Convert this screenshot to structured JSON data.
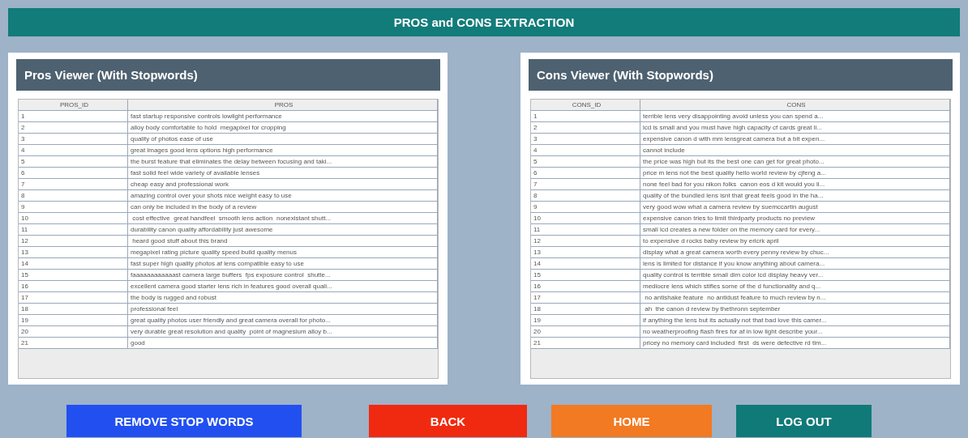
{
  "title": "PROS and CONS EXTRACTION",
  "viewers": [
    {
      "title": "Pros Viewer (With Stopwords)",
      "columns": [
        "PROS_ID",
        "PROS"
      ],
      "rows": [
        {
          "id": "1",
          "text": "fast startup responsive controls lowlight performance"
        },
        {
          "id": "2",
          "text": "alloy body comfortable to hold  megapixel for cropping"
        },
        {
          "id": "3",
          "text": "quality of photos ease of use"
        },
        {
          "id": "4",
          "text": "great images good lens options high performance"
        },
        {
          "id": "5",
          "text": "the burst feature that eliminates the delay between focusing and taki..."
        },
        {
          "id": "6",
          "text": "fast solid feel wide variety of available lenses"
        },
        {
          "id": "7",
          "text": "cheap easy and professional work"
        },
        {
          "id": "8",
          "text": "amazing control over your shots nice weight easy to use"
        },
        {
          "id": "9",
          "text": "can only be included in the body of a review"
        },
        {
          "id": "10",
          "text": " cost effective  great handfeel  smooth lens action  nonexistant shutt..."
        },
        {
          "id": "11",
          "text": "durability canon quality affordability just awesome"
        },
        {
          "id": "12",
          "text": " heard good stuff about this brand"
        },
        {
          "id": "13",
          "text": "megapixel rating picture quality speed build quality menus"
        },
        {
          "id": "14",
          "text": "fast super high quality photos af lens compatible easy to use"
        },
        {
          "id": "15",
          "text": "faaaaaaaaaaaast camera large buffers  fps exposure control  shutte..."
        },
        {
          "id": "16",
          "text": "excellent camera good starter lens rich in features good overall quali..."
        },
        {
          "id": "17",
          "text": "the body is rugged and robust"
        },
        {
          "id": "18",
          "text": "professional feel"
        },
        {
          "id": "19",
          "text": "great quality photos user friendly and great camera overall for photo..."
        },
        {
          "id": "20",
          "text": "very durable great resolution and quality  point of magnesium alloy b..."
        },
        {
          "id": "21",
          "text": "good"
        }
      ]
    },
    {
      "title": "Cons Viewer (With Stopwords)",
      "columns": [
        "CONS_ID",
        "CONS"
      ],
      "rows": [
        {
          "id": "1",
          "text": "terrible lens very disappointing avoid unless you can spend a..."
        },
        {
          "id": "2",
          "text": "lcd is small and you must have high capacity cf cards great li..."
        },
        {
          "id": "3",
          "text": "expensive canon d with mm lensgreat camera but a bit expen..."
        },
        {
          "id": "4",
          "text": "cannot include"
        },
        {
          "id": "5",
          "text": "the price was high but its the best one can get for great photo..."
        },
        {
          "id": "6",
          "text": "price m lens not the best quality hello world review by cjfeng a..."
        },
        {
          "id": "7",
          "text": "none feel bad for you nikon folks  canon eos d kit would you li..."
        },
        {
          "id": "8",
          "text": "quality of the bundled lens isnt that great feels good in the ha..."
        },
        {
          "id": "9",
          "text": "very good wow what a camera review by suemccartin august"
        },
        {
          "id": "10",
          "text": "expensive canon tries to limit thirdparty products no preview"
        },
        {
          "id": "11",
          "text": "small lcd creates a new folder on the memory card for every..."
        },
        {
          "id": "12",
          "text": "to expensive d rocks baby review by ericrk april"
        },
        {
          "id": "13",
          "text": "display what a great camera worth every penny review by chuc..."
        },
        {
          "id": "14",
          "text": "lens is limited for distance if you know anything about camera..."
        },
        {
          "id": "15",
          "text": "quality control is terrible small dim color lcd display heavy ver..."
        },
        {
          "id": "16",
          "text": "mediocre lens which stifles some of the d functionality and q..."
        },
        {
          "id": "17",
          "text": " no antishake feature  no antidust feature to much review by n..."
        },
        {
          "id": "18",
          "text": " ah  the canon d review by thethronn september"
        },
        {
          "id": "19",
          "text": "if anything the lens but its actually not that bad love this camer..."
        },
        {
          "id": "20",
          "text": "no weatherproofing flash fires for af in low light describe your..."
        },
        {
          "id": "21",
          "text": "pricey no memory card included  first  ds were defective rd tim..."
        }
      ]
    }
  ],
  "buttons": [
    {
      "label": "REMOVE STOP WORDS",
      "color": "#2250f0"
    },
    {
      "label": "BACK",
      "color": "#f02a10"
    },
    {
      "label": "HOME",
      "color": "#f27a22"
    },
    {
      "label": "LOG OUT",
      "color": "#107a78"
    }
  ]
}
